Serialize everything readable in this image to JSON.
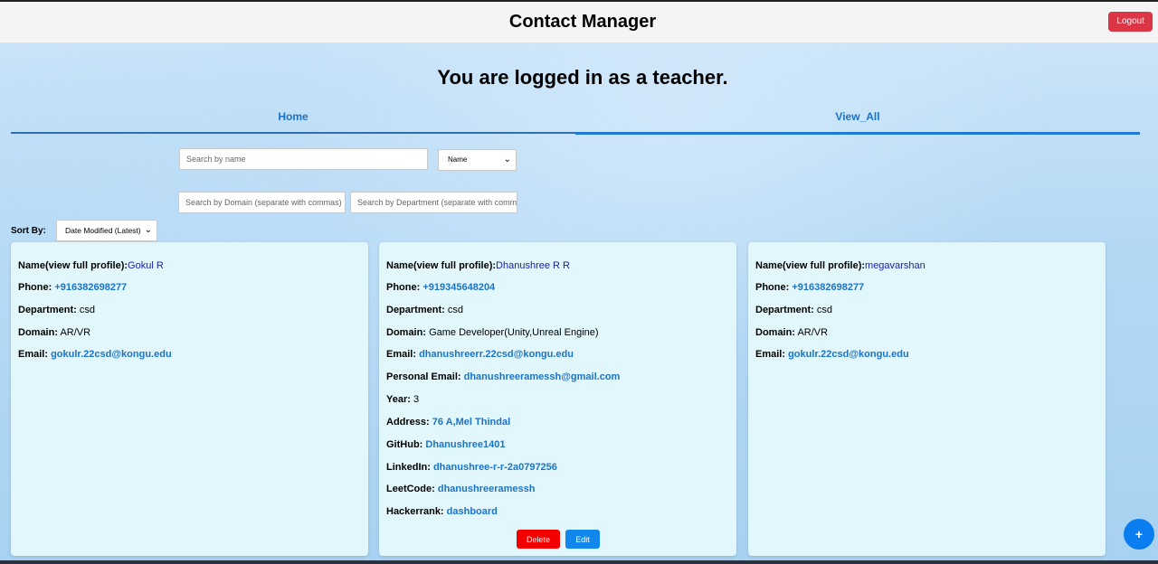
{
  "header": {
    "title": "Contact Manager",
    "logout_label": "Logout"
  },
  "welcome": "You are logged in as a teacher.",
  "tabs": [
    {
      "label": "Home"
    },
    {
      "label": "View_All"
    }
  ],
  "filters": {
    "name_placeholder": "Search by name",
    "search_type_selected": "Name",
    "domain_placeholder": "Search by Domain (separate with commas)",
    "department_placeholder": "Search by Department (separate with commas)"
  },
  "sort": {
    "label": "Sort By:",
    "selected": "Date Modified (Latest)"
  },
  "cards": [
    {
      "name_label": "Name(view full profile):",
      "name": "Gokul R",
      "phone_label": "Phone:",
      "phone": "+916382698277",
      "department_label": "Department:",
      "department": "csd",
      "domain_label": "Domain:",
      "domain": "AR/VR",
      "email_label": "Email:",
      "email": "gokulr.22csd@kongu.edu"
    },
    {
      "name_label": "Name(view full profile):",
      "name": "Dhanushree R R",
      "phone_label": "Phone:",
      "phone": "+919345648204",
      "department_label": "Department:",
      "department": "csd",
      "domain_label": "Domain:",
      "domain": "Game Developer(Unity,Unreal Engine)",
      "email_label": "Email:",
      "email": "dhanushreerr.22csd@kongu.edu",
      "personal_email_label": "Personal Email:",
      "personal_email": "dhanushreeramessh@gmail.com",
      "year_label": "Year:",
      "year": "3",
      "address_label": "Address:",
      "address": "76 A,Mel Thindal",
      "github_label": "GitHub:",
      "github": "Dhanushree1401",
      "linkedin_label": "LinkedIn:",
      "linkedin": "dhanushree-r-r-2a0797256",
      "leetcode_label": "LeetCode:",
      "leetcode": "dhanushreeramessh",
      "hackerrank_label": "Hackerrank:",
      "hackerrank": "dashboard",
      "delete_label": "Delete",
      "edit_label": "Edit"
    },
    {
      "name_label": "Name(view full profile):",
      "name": "megavarshan",
      "phone_label": "Phone:",
      "phone": "+916382698277",
      "department_label": "Department:",
      "department": "csd",
      "domain_label": "Domain:",
      "domain": "AR/VR",
      "email_label": "Email:",
      "email": "gokulr.22csd@kongu.edu"
    }
  ],
  "fab_label": "+",
  "colors": {
    "accent": "#1a73c8",
    "logout": "#dc3545",
    "delete": "#f20000",
    "edit": "#1187ee",
    "card": "#e2f7fb"
  }
}
